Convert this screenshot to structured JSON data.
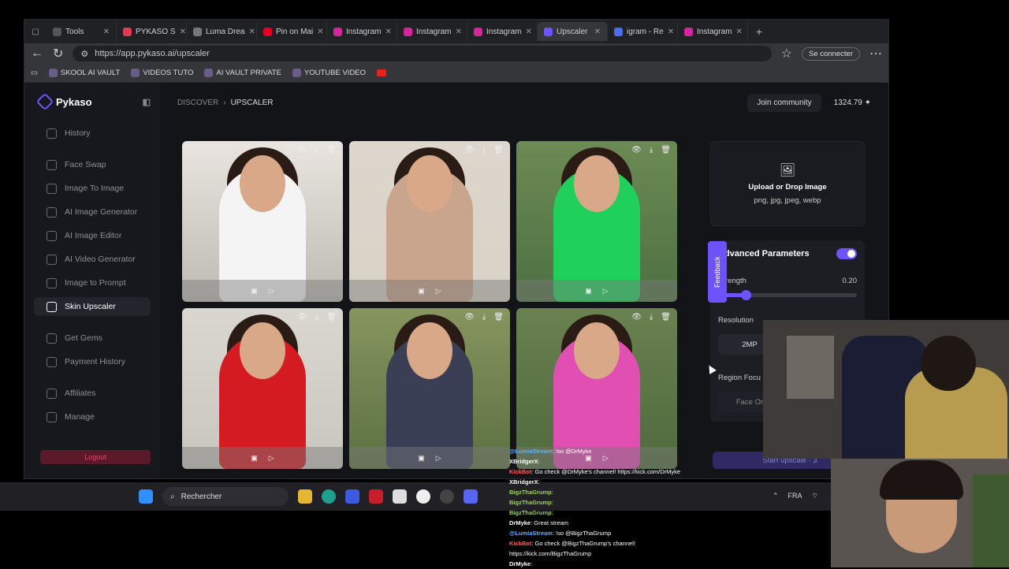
{
  "browser": {
    "tabs": [
      {
        "label": "Tools",
        "color": "#555",
        "active": false
      },
      {
        "label": "PYKASO S",
        "color": "#e03b52",
        "active": false
      },
      {
        "label": "Luma Drea",
        "color": "#777",
        "active": false
      },
      {
        "label": "Pin on Mai",
        "color": "#e60023",
        "active": false
      },
      {
        "label": "Instagram",
        "color": "#d6249f",
        "active": false
      },
      {
        "label": "Instagram",
        "color": "#d6249f",
        "active": false
      },
      {
        "label": "Instagram",
        "color": "#d6249f",
        "active": false
      },
      {
        "label": "Upscaler",
        "color": "#6f52ff",
        "active": true
      },
      {
        "label": "igram - Re",
        "color": "#4a6cf7",
        "active": false
      },
      {
        "label": "Instagram",
        "color": "#d6249f",
        "active": false
      }
    ],
    "url": "https://app.pykaso.ai/upscaler",
    "signin_label": "Se connecter",
    "bookmarks": [
      "SKOOL AI VAULT",
      "VIDEOS TUTO",
      "AI VAULT PRIVATE",
      "YOUTUBE VIDEO"
    ]
  },
  "app": {
    "logo": "Pykaso",
    "nav": [
      {
        "label": "History"
      },
      {
        "label": "Face Swap"
      },
      {
        "label": "Image To Image"
      },
      {
        "label": "AI Image Generator"
      },
      {
        "label": "AI Image Editor"
      },
      {
        "label": "AI Video Generator"
      },
      {
        "label": "Image to Prompt"
      },
      {
        "label": "Skin Upscaler",
        "active": true
      },
      {
        "label": "Get Gems"
      },
      {
        "label": "Payment History"
      },
      {
        "label": "Affiliates"
      },
      {
        "label": "Manage"
      }
    ],
    "logout_label": "Logout",
    "breadcrumb": {
      "discover": "DISCOVER",
      "current": "UPSCALER"
    },
    "community_label": "Join community",
    "credits": "1324.79",
    "images": [
      {
        "top": "#e9e4df",
        "outfit": "#f4f4f4",
        "bg": "#bdbab3"
      },
      {
        "top": "#ddd6cc",
        "outfit": "#c9a58d",
        "bg": "#d8d2c7"
      },
      {
        "top": "#6b8a54",
        "outfit": "#1fd15a",
        "bg": "#4f7043"
      },
      {
        "top": "#d9d7d0",
        "outfit": "#d41b22",
        "bg": "#c9c6be"
      },
      {
        "top": "#87955f",
        "outfit": "#3a3f56",
        "bg": "#5c7042"
      },
      {
        "top": "#6a8150",
        "outfit": "#e24fb3",
        "bg": "#4f6a3e"
      }
    ],
    "upload": {
      "title": "Upload or Drop Image",
      "formats": "png, jpg, jpeg, webp"
    },
    "advanced": {
      "title": "Advanced Parameters",
      "strength_label": "Strength",
      "strength_value": "0.20",
      "strength_fraction": 0.2,
      "resolution_label": "Resolution",
      "resolution_value": "2MP",
      "region_label": "Region Focu",
      "face_label": "Face Or"
    },
    "feedback_label": "Feedback",
    "start_label": "Start upscale · 3"
  },
  "taskbar": {
    "search_placeholder": "Rechercher",
    "lang": "FRA"
  },
  "chat": [
    {
      "user": "@LumiaStream",
      "cls": "u1",
      "text": ": !so @DrMyke"
    },
    {
      "user": "XBridgerX",
      "cls": "",
      "text": ":"
    },
    {
      "user": "KickBot",
      "cls": "u2",
      "text": ": Go check @DrMyke's channel! https://kick.com/DrMyke"
    },
    {
      "user": "XBridgerX",
      "cls": "",
      "text": ":"
    },
    {
      "user": "BigzThaGrump",
      "cls": "u3",
      "text": ":"
    },
    {
      "user": "BigzThaGrump",
      "cls": "u3",
      "text": ":"
    },
    {
      "user": "BigzThaGrump",
      "cls": "u3",
      "text": ":"
    },
    {
      "user": "DrMyke",
      "cls": "",
      "text": ": Great stream"
    },
    {
      "user": "@LumiaStream",
      "cls": "u1",
      "text": ": !so @BigzThaGrump"
    },
    {
      "user": "KickBot",
      "cls": "u2",
      "text": ": Go check @BigzThaGrump's channel!"
    },
    {
      "user": "",
      "cls": "",
      "text": "https://kick.com/BigzThaGrump"
    },
    {
      "user": "DrMyke",
      "cls": "",
      "text": ":"
    }
  ]
}
